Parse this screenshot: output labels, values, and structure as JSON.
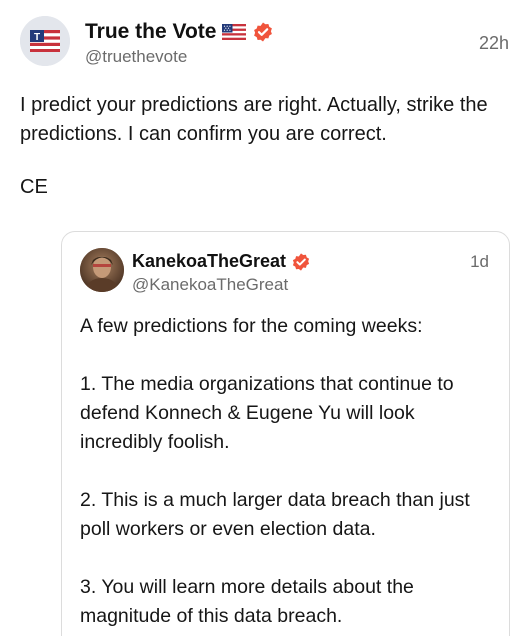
{
  "post": {
    "display_name": "True the Vote",
    "handle": "@truethevote",
    "time": "22h",
    "text": "I predict your predictions are right. Actually, strike the predictions. I can confirm you are correct.",
    "signature": "CE",
    "avatar_letter": "T"
  },
  "quote": {
    "display_name": "KanekoaTheGreat",
    "handle": "@KanekoaTheGreat",
    "time": "1d",
    "paragraphs": [
      "A few predictions for the coming weeks:",
      "1. The media organizations that continue to defend Konnech & Eugene Yu will look incredibly foolish.",
      "2. This is a much larger data breach than just poll workers or even election data.",
      "3. You will learn more details about the magnitude of this data breach."
    ]
  },
  "colors": {
    "verified": "#f0543c",
    "flag_blue": "#233a7a",
    "flag_red": "#c8323c"
  },
  "icons": {
    "flag": "us-flag-icon",
    "verified": "verified-badge-icon"
  }
}
